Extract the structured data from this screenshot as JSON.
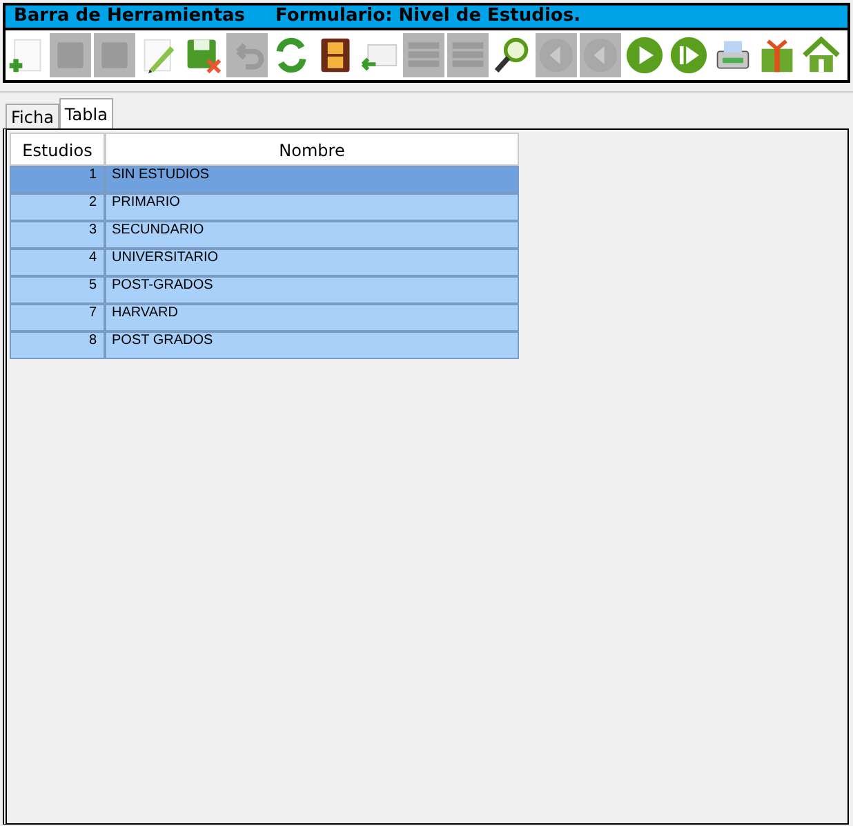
{
  "toolbar": {
    "title": "Barra de Herramientas",
    "form_title": "Formulario: Nivel de Estudios.",
    "buttons": [
      {
        "kind": "new",
        "disabled": false
      },
      {
        "kind": "save",
        "disabled": true
      },
      {
        "kind": "saveas",
        "disabled": true
      },
      {
        "kind": "edit",
        "disabled": false
      },
      {
        "kind": "savecancel",
        "disabled": false
      },
      {
        "kind": "undo",
        "disabled": true
      },
      {
        "kind": "refresh",
        "disabled": false
      },
      {
        "kind": "film",
        "disabled": false
      },
      {
        "kind": "mail",
        "disabled": false
      },
      {
        "kind": "list",
        "disabled": true
      },
      {
        "kind": "list",
        "disabled": true
      },
      {
        "kind": "search",
        "disabled": false
      },
      {
        "kind": "first",
        "disabled": true
      },
      {
        "kind": "prev",
        "disabled": true
      },
      {
        "kind": "next",
        "disabled": false
      },
      {
        "kind": "last",
        "disabled": false
      },
      {
        "kind": "print",
        "disabled": false
      },
      {
        "kind": "gift",
        "disabled": false
      },
      {
        "kind": "home",
        "disabled": false
      }
    ]
  },
  "tabs": [
    {
      "label": "Ficha",
      "selected": false
    },
    {
      "label": "Tabla",
      "selected": true
    }
  ],
  "table": {
    "columns": [
      "Estudios",
      "Nombre"
    ],
    "rows": [
      {
        "id": "1",
        "name": "SIN ESTUDIOS",
        "selected": true
      },
      {
        "id": "2",
        "name": "PRIMARIO",
        "selected": false
      },
      {
        "id": "3",
        "name": "SECUNDARIO",
        "selected": false
      },
      {
        "id": "4",
        "name": "UNIVERSITARIO",
        "selected": false
      },
      {
        "id": "5",
        "name": "POST-GRADOS",
        "selected": false
      },
      {
        "id": "7",
        "name": "HARVARD",
        "selected": false
      },
      {
        "id": "8",
        "name": "POST GRADOS",
        "selected": false
      }
    ]
  }
}
